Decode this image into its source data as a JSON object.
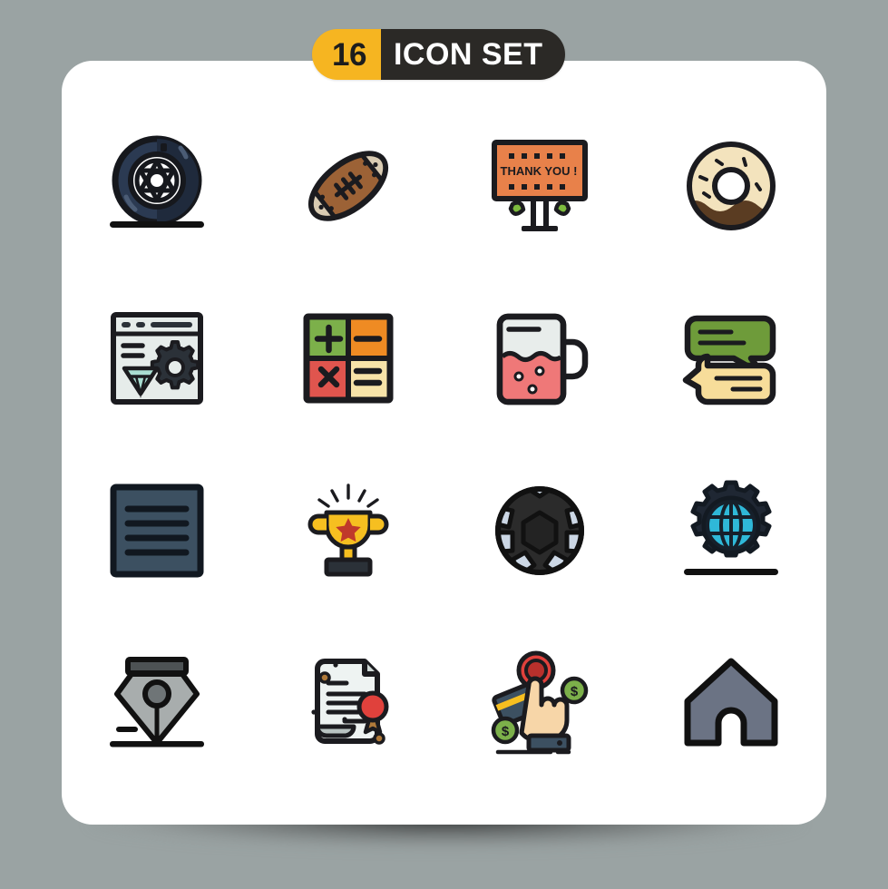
{
  "header": {
    "count": "16",
    "title": "ICON SET",
    "badge_count_bg": "#f6b521",
    "badge_title_bg": "#2b2926",
    "badge_title_color": "#ffffff"
  },
  "canvas": {
    "background": "#9aa3a3",
    "card_background": "#ffffff",
    "card_radius": "34px"
  },
  "grid": {
    "columns": 4,
    "rows": 4,
    "total": 16
  },
  "icons": [
    {
      "index": 1,
      "name": "tire-wheel-icon",
      "label": "Tire",
      "row": 1,
      "col": 1,
      "colors": [
        "#2b3a52",
        "#1b1b1f",
        "#ffffff"
      ]
    },
    {
      "index": 2,
      "name": "american-football-icon",
      "label": "Rugby Ball",
      "row": 1,
      "col": 2,
      "colors": [
        "#9c6236",
        "#d9cbb2",
        "#1b1b1f"
      ]
    },
    {
      "index": 3,
      "name": "thank-you-board-icon",
      "label": "Thank You Billboard",
      "row": 1,
      "col": 3,
      "colors": [
        "#e8814a",
        "#7dbb3e",
        "#1b1b1f"
      ],
      "text": "THANK YOU !"
    },
    {
      "index": 4,
      "name": "donut-icon",
      "label": "Donut",
      "row": 1,
      "col": 4,
      "colors": [
        "#f3e3bd",
        "#5a3c22",
        "#1b1b1f"
      ]
    },
    {
      "index": 5,
      "name": "web-design-settings-icon",
      "label": "Web Design Settings",
      "row": 2,
      "col": 1,
      "colors": [
        "#e6ecea",
        "#2b3138",
        "#a9ded2"
      ]
    },
    {
      "index": 6,
      "name": "calculator-operations-icon",
      "label": "Calculator",
      "row": 2,
      "col": 2,
      "colors": [
        "#7cb04a",
        "#ef8b23",
        "#e0554e",
        "#f7e3a8"
      ]
    },
    {
      "index": 7,
      "name": "beer-mug-icon",
      "label": "Mug Drink",
      "row": 2,
      "col": 3,
      "colors": [
        "#e8edeb",
        "#ef7878",
        "#1b1b1f"
      ]
    },
    {
      "index": 8,
      "name": "chat-bubbles-icon",
      "label": "Chat",
      "row": 2,
      "col": 4,
      "colors": [
        "#6e9b3a",
        "#f7dd9a",
        "#1b1b1f"
      ]
    },
    {
      "index": 9,
      "name": "menu-list-icon",
      "label": "Menu",
      "row": 3,
      "col": 1,
      "colors": [
        "#3c5061",
        "#111820"
      ]
    },
    {
      "index": 10,
      "name": "trophy-icon",
      "label": "Trophy",
      "row": 3,
      "col": 2,
      "colors": [
        "#f6bf20",
        "#c0392b",
        "#2b3138"
      ]
    },
    {
      "index": 11,
      "name": "soccer-ball-icon",
      "label": "Football",
      "row": 3,
      "col": 3,
      "colors": [
        "#2b2b2b",
        "#ccd7e5",
        "#111111"
      ]
    },
    {
      "index": 12,
      "name": "global-gear-icon",
      "label": "Global Settings",
      "row": 3,
      "col": 4,
      "colors": [
        "#1f2733",
        "#2fb8d8",
        "#3d5a80"
      ]
    },
    {
      "index": 13,
      "name": "pen-nib-icon",
      "label": "Pen Tool",
      "row": 4,
      "col": 1,
      "colors": [
        "#a8adad",
        "#6f7577",
        "#111111"
      ]
    },
    {
      "index": 14,
      "name": "certificate-icon",
      "label": "Certificate",
      "row": 4,
      "col": 2,
      "colors": [
        "#eef3f2",
        "#e0413c",
        "#b07a3a"
      ]
    },
    {
      "index": 15,
      "name": "pay-per-click-icon",
      "label": "Pay Per Click",
      "row": 4,
      "col": 3,
      "colors": [
        "#f7d6a8",
        "#e0413c",
        "#7cb04a",
        "#3c5061"
      ]
    },
    {
      "index": 16,
      "name": "home-icon",
      "label": "Home",
      "row": 4,
      "col": 4,
      "colors": [
        "#6b7384",
        "#111111"
      ]
    }
  ]
}
